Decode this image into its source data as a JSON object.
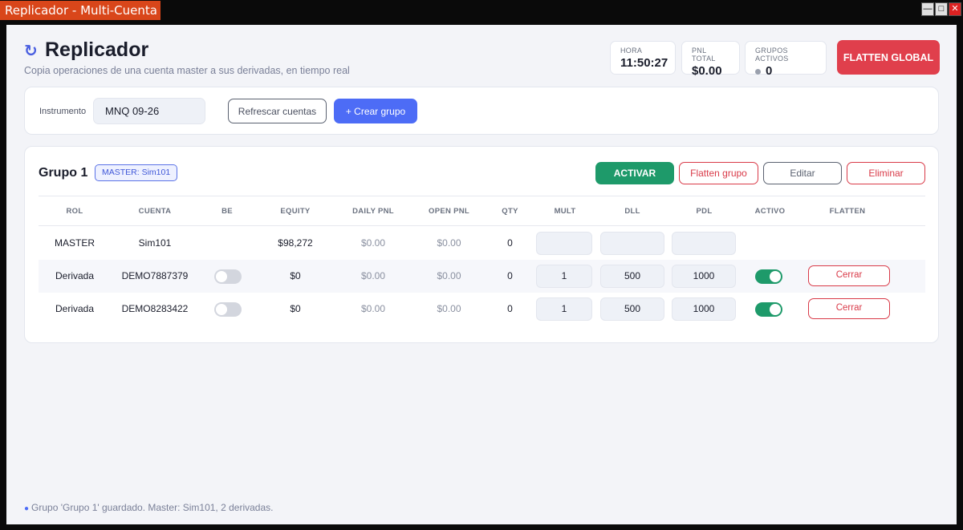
{
  "window": {
    "title": "Replicador - Multi-Cuenta"
  },
  "header": {
    "title": "Replicador",
    "subtitle": "Copia operaciones de una cuenta master a sus derivadas, en tiempo real"
  },
  "stats": {
    "hora_label": "HORA",
    "hora_value": "11:50:27",
    "pnl_label": "PNL TOTAL",
    "pnl_value": "$0.00",
    "grupos_label": "GRUPOS ACTIVOS",
    "grupos_value": "0"
  },
  "flatten_global": "FLATTEN GLOBAL",
  "toolbar": {
    "instrumento_label": "Instrumento",
    "instrumento_value": "MNQ 09-26",
    "refresh_label": "Refrescar cuentas",
    "create_label": "+ Crear grupo"
  },
  "group": {
    "name": "Grupo 1",
    "master_badge": "MASTER: Sim101",
    "activate_label": "ACTIVAR",
    "flatten_label": "Flatten grupo",
    "edit_label": "Editar",
    "delete_label": "Eliminar",
    "columns": [
      "ROL",
      "CUENTA",
      "BE",
      "EQUITY",
      "DAILY PNL",
      "OPEN PNL",
      "QTY",
      "MULT",
      "DLL",
      "PDL",
      "ACTIVO",
      "FLATTEN"
    ],
    "rows": [
      {
        "rol": "MASTER",
        "cuenta": "Sim101",
        "equity": "$98,272",
        "daily_pnl": "$0.00",
        "open_pnl": "$0.00",
        "qty": "0",
        "mult": "",
        "dll": "",
        "pdl": ""
      },
      {
        "rol": "Derivada",
        "cuenta": "DEMO7887379",
        "be": false,
        "equity": "$0",
        "daily_pnl": "$0.00",
        "open_pnl": "$0.00",
        "qty": "0",
        "mult": "1",
        "dll": "500",
        "pdl": "1000",
        "activo": true,
        "flatten": "Cerrar"
      },
      {
        "rol": "Derivada",
        "cuenta": "DEMO8283422",
        "be": false,
        "equity": "$0",
        "daily_pnl": "$0.00",
        "open_pnl": "$0.00",
        "qty": "0",
        "mult": "1",
        "dll": "500",
        "pdl": "1000",
        "activo": true,
        "flatten": "Cerrar"
      }
    ]
  },
  "status_message": "Grupo 'Grupo 1' guardado. Master: Sim101, 2 derivadas.",
  "colors": {
    "accent": "#4d6cf6",
    "danger": "#e03f4c",
    "success": "#1e9a6a"
  }
}
